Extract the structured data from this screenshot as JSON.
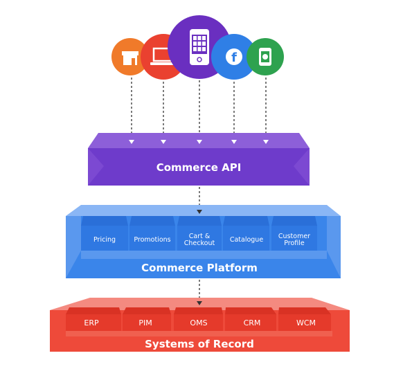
{
  "channels": [
    {
      "icon": "storefront-icon",
      "color": "#f07a2a"
    },
    {
      "icon": "laptop-icon",
      "color": "#ea4130"
    },
    {
      "icon": "mobile-app-icon",
      "color": "#6a2fc0"
    },
    {
      "icon": "facebook-icon",
      "color": "#2f7fe6"
    },
    {
      "icon": "smartwatch-icon",
      "color": "#2ea24f"
    }
  ],
  "api": {
    "title": "Commerce API",
    "color": "#6e3bcb"
  },
  "platform": {
    "title": "Commerce Platform",
    "color": "#2f7de3",
    "modules": [
      [
        "Pricing"
      ],
      [
        "Promotions"
      ],
      [
        "Cart &",
        "Checkout"
      ],
      [
        "Catalogue"
      ],
      [
        "Customer",
        "Profile"
      ]
    ]
  },
  "record": {
    "title": "Systems of Record",
    "color": "#ec3b2c",
    "modules": [
      "ERP",
      "PIM",
      "OMS",
      "CRM",
      "WCM"
    ]
  }
}
